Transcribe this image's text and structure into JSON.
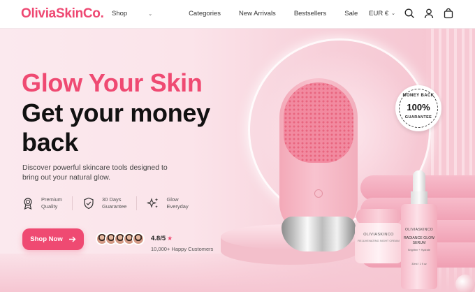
{
  "brand": {
    "logo": "OliviaSkinCo.",
    "accent": "#ee4872"
  },
  "nav": {
    "items": [
      {
        "label": "Shop",
        "has_dropdown": true
      },
      {
        "label": "Categories"
      },
      {
        "label": "New Arrivals"
      },
      {
        "label": "Bestsellers"
      },
      {
        "label": "Sale"
      }
    ],
    "currency": "EUR €",
    "icons": [
      "search-icon",
      "user-icon",
      "cart-icon"
    ]
  },
  "hero": {
    "headline_accent": "Glow Your Skin",
    "headline_main": "Get your money back",
    "description": "Discover powerful skincare tools designed to bring out your natural glow.",
    "features": [
      {
        "icon": "award-icon",
        "line1": "Premium",
        "line2": "Quality"
      },
      {
        "icon": "shield-check-icon",
        "line1": "30 Days",
        "line2": "Guarantee"
      },
      {
        "icon": "sparkles-icon",
        "line1": "Glow",
        "line2": "Everyday"
      }
    ],
    "cta_label": "Shop Now",
    "rating": {
      "score": "4.8/5",
      "customers": "10,000+ Happy Customers"
    }
  },
  "badge": {
    "top": "MONEY BACK",
    "middle": "100%",
    "bottom": "GUARANTEE"
  },
  "products": {
    "jar": {
      "brand": "OLIVIASKINCO",
      "name": "REJUVENATING NIGHT CREAM"
    },
    "serum": {
      "brand": "OLIVIASKINCO",
      "name": "RADIANCE GLOW SERUM",
      "sub": "Brighten + Hydrate",
      "volume": "30ml / 1 fl oz"
    }
  }
}
